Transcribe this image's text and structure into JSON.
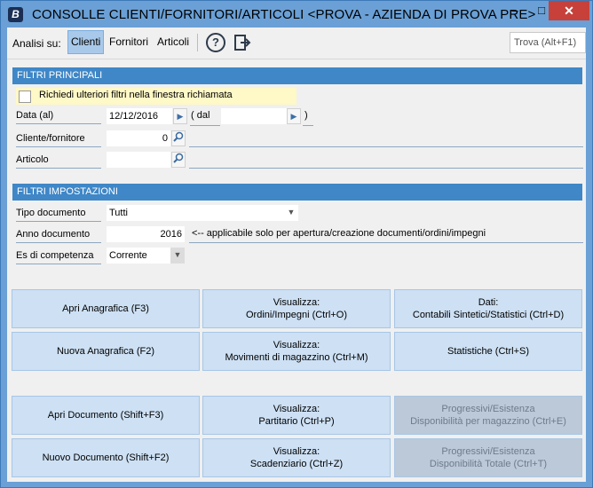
{
  "titlebar": {
    "app_icon": "B",
    "title": "CONSOLLE CLIENTI/FORNITORI/ARTICOLI <PROVA - AZIENDA DI PROVA PRE>",
    "minimize": "–",
    "maximize": "□",
    "close": "✕"
  },
  "toolbar": {
    "analisi_label": "Analisi su:",
    "tabs": [
      "Clienti",
      "Fornitori",
      "Articoli"
    ],
    "active_tab": "Clienti",
    "help_icon": "?",
    "search_placeholder": "Trova (Alt+F1)"
  },
  "filtri_principali": {
    "header": "FILTRI PRINCIPALI",
    "checkbox_label": "Richiedi ulteriori filtri nella finestra richiamata",
    "data_label": "Data (al)",
    "data_value": "12/12/2016",
    "dal_label": "( dal",
    "dal_value": "",
    "close_paren": ")",
    "cliente_label": "Cliente/fornitore",
    "cliente_value": "0",
    "articolo_label": "Articolo",
    "articolo_value": ""
  },
  "filtri_impostazioni": {
    "header": "FILTRI IMPOSTAZIONI",
    "tipo_label": "Tipo documento",
    "tipo_value": "Tutti",
    "anno_label": "Anno documento",
    "anno_value": "2016",
    "anno_note": "<-- applicabile solo per apertura/creazione documenti/ordini/impegni",
    "es_label": "Es di competenza",
    "es_value": "Corrente"
  },
  "buttons": {
    "apri_anagrafica": "Apri Anagrafica (F3)",
    "visualizza_ordini": "Visualizza:\nOrdini/Impegni (Ctrl+O)",
    "dati_contabili": "Dati:\nContabili Sintetici/Statistici (Ctrl+D)",
    "nuova_anagrafica": "Nuova Anagrafica (F2)",
    "visualizza_movimenti": "Visualizza:\nMovimenti di magazzino (Ctrl+M)",
    "statistiche": "Statistiche (Ctrl+S)",
    "apri_documento": "Apri Documento (Shift+F3)",
    "visualizza_partitario": "Visualizza:\nPartitario (Ctrl+P)",
    "progressivi_magazzino": "Progressivi/Esistenza\nDisponibilità per magazzino (Ctrl+E)",
    "nuovo_documento": "Nuovo Documento (Shift+F2)",
    "visualizza_scadenziario": "Visualizza:\nScadenziario (Ctrl+Z)",
    "progressivi_totale": "Progressivi/Esistenza\nDisponibilità Totale (Ctrl+T)"
  },
  "colors": {
    "frame": "#6aa0d6",
    "section_header": "#3f87c7",
    "button": "#cde0f4",
    "button_disabled": "#bcc9d8",
    "checkbox_row": "#fff8c7",
    "close_button": "#c7403a"
  }
}
